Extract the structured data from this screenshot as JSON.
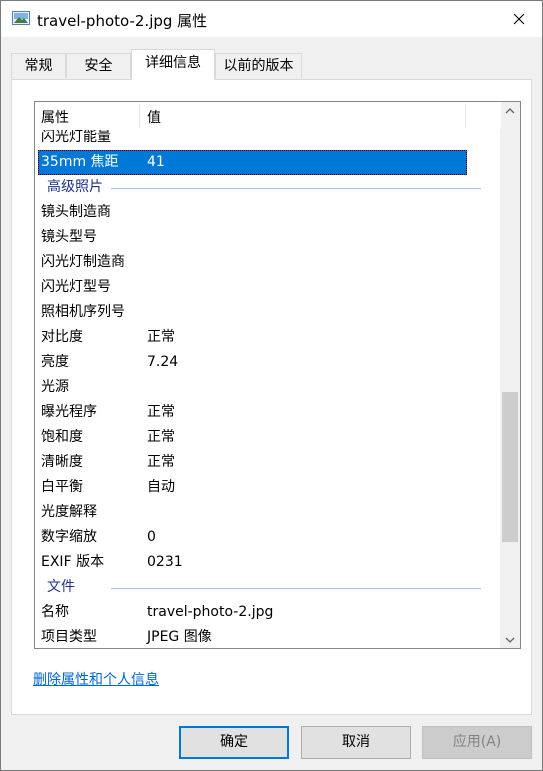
{
  "window": {
    "title": "travel-photo-2.jpg 属性"
  },
  "tabs": [
    {
      "label": "常规"
    },
    {
      "label": "安全"
    },
    {
      "label": "详细信息"
    },
    {
      "label": "以前的版本"
    }
  ],
  "list": {
    "header": {
      "name": "属性",
      "value": "值"
    },
    "rows": [
      {
        "name": "闪光灯能量",
        "value": ""
      },
      {
        "name": "35mm 焦距",
        "value": "41",
        "selected": true
      },
      {
        "group": "高级照片"
      },
      {
        "name": "镜头制造商",
        "value": ""
      },
      {
        "name": "镜头型号",
        "value": ""
      },
      {
        "name": "闪光灯制造商",
        "value": ""
      },
      {
        "name": "闪光灯型号",
        "value": ""
      },
      {
        "name": "照相机序列号",
        "value": ""
      },
      {
        "name": "对比度",
        "value": "正常"
      },
      {
        "name": "亮度",
        "value": "7.24"
      },
      {
        "name": "光源",
        "value": ""
      },
      {
        "name": "曝光程序",
        "value": "正常"
      },
      {
        "name": "饱和度",
        "value": "正常"
      },
      {
        "name": "清晰度",
        "value": "正常"
      },
      {
        "name": "白平衡",
        "value": "自动"
      },
      {
        "name": "光度解释",
        "value": ""
      },
      {
        "name": "数字缩放",
        "value": "0"
      },
      {
        "name": "EXIF 版本",
        "value": "0231"
      },
      {
        "group": "文件"
      },
      {
        "name": "名称",
        "value": "travel-photo-2.jpg"
      },
      {
        "name": "项目类型",
        "value": "JPEG 图像"
      }
    ]
  },
  "link": {
    "remove_properties": "删除属性和个人信息"
  },
  "buttons": {
    "ok": "确定",
    "cancel": "取消",
    "apply": "应用(A)"
  }
}
